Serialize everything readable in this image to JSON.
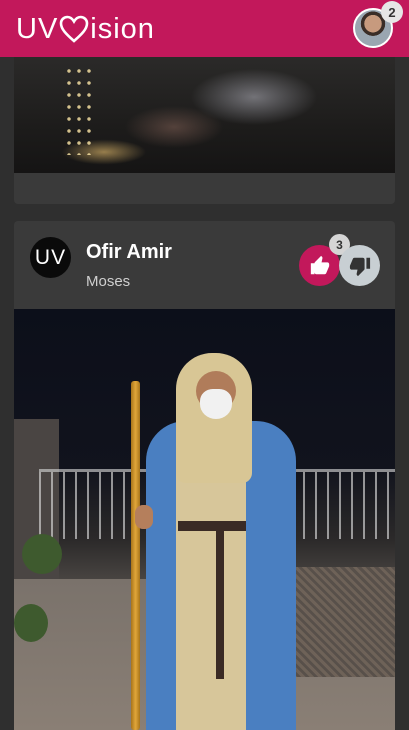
{
  "header": {
    "logo_left": "UV",
    "logo_right": "ision",
    "notification_count": "2"
  },
  "post": {
    "avatar_text": "UV",
    "author": "Ofir Amir",
    "costume": "Moses",
    "like_count": "3"
  },
  "colors": {
    "brand": "#c2185b",
    "card_bg": "#3a3a3a",
    "page_bg": "#2f2f2f"
  },
  "icons": [
    "heart-icon",
    "thumbs-up-icon",
    "thumbs-down-icon"
  ]
}
